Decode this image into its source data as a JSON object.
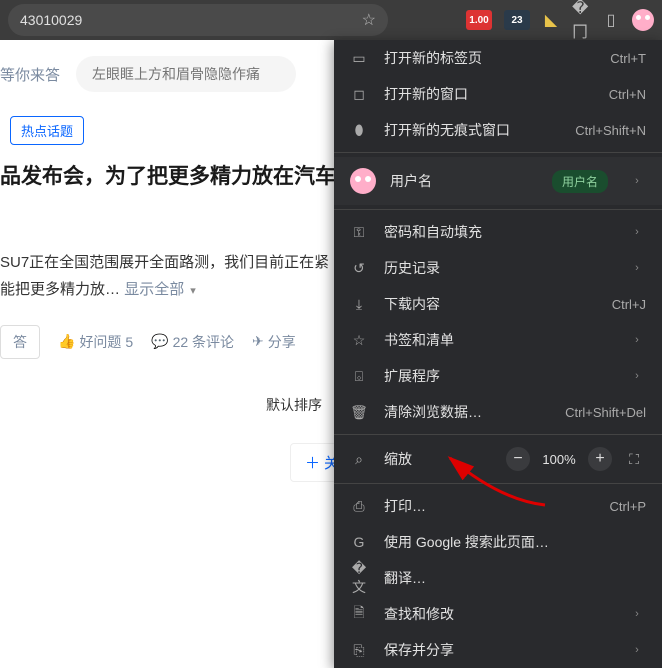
{
  "toolbar": {
    "url": "43010029",
    "ext_badges": [
      "1.00",
      "23"
    ]
  },
  "page": {
    "search_link": "等你来答",
    "search_placeholder": "左眼眶上方和眉骨隐隐作痛",
    "tag": "热点话题",
    "headline": "品发布会，为了把更多精力放在汽车",
    "body_line1": "SU7正在全国范围展开全面路测，我们目前正在紧",
    "body_line2": "能把更多精力放…",
    "show_all": "显示全部",
    "answer_btn": "答",
    "good_q": "好问题 5",
    "comments": "22 条评论",
    "share": "分享",
    "sort": "默认排序",
    "follow": "关注"
  },
  "menu": {
    "new_tab": {
      "label": "打开新的标签页",
      "shortcut": "Ctrl+T"
    },
    "new_window": {
      "label": "打开新的窗口",
      "shortcut": "Ctrl+N"
    },
    "incognito": {
      "label": "打开新的无痕式窗口",
      "shortcut": "Ctrl+Shift+N"
    },
    "user": {
      "name": "用户名",
      "badge": "用户名"
    },
    "passwords": {
      "label": "密码和自动填充"
    },
    "history": {
      "label": "历史记录"
    },
    "downloads": {
      "label": "下载内容",
      "shortcut": "Ctrl+J"
    },
    "bookmarks": {
      "label": "书签和清单"
    },
    "extensions": {
      "label": "扩展程序"
    },
    "clear_data": {
      "label": "清除浏览数据…",
      "shortcut": "Ctrl+Shift+Del"
    },
    "zoom": {
      "label": "缩放",
      "value": "100%"
    },
    "print": {
      "label": "打印…",
      "shortcut": "Ctrl+P"
    },
    "google_search": {
      "label": "使用 Google 搜索此页面…"
    },
    "translate": {
      "label": "翻译…"
    },
    "find_edit": {
      "label": "查找和修改"
    },
    "save_share": {
      "label": "保存并分享"
    }
  }
}
